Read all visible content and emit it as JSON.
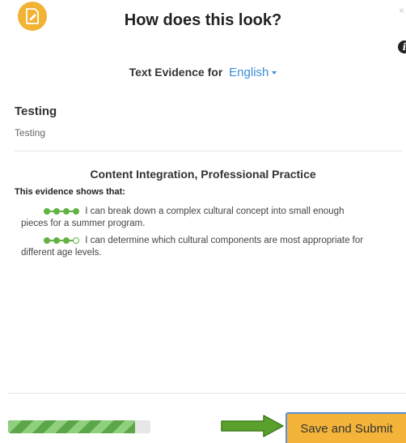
{
  "header": {
    "title": "How does this look?",
    "close_glyph": "×",
    "info_glyph": "i"
  },
  "evidence_for": {
    "label": "Text Evidence for",
    "language": "English"
  },
  "entry": {
    "title": "Testing",
    "text": "Testing"
  },
  "evidence": {
    "category": "Content Integration, Professional Practice",
    "intro": "This evidence shows that:",
    "statements": [
      {
        "level": 4,
        "max": 4,
        "line1": "I can break down a complex cultural concept into small enough",
        "line2": "pieces for a summer program."
      },
      {
        "level": 3,
        "max": 4,
        "line1": "I can determine which cultural components are most appropriate for",
        "line2": "different age levels."
      }
    ]
  },
  "footer": {
    "progress": 0.89,
    "submit_label": "Save and Submit"
  },
  "colors": {
    "accent_orange": "#f2b233",
    "link_blue": "#3a8ed8",
    "dot_green": "#62b343",
    "arrow_green": "#5aa02c"
  }
}
